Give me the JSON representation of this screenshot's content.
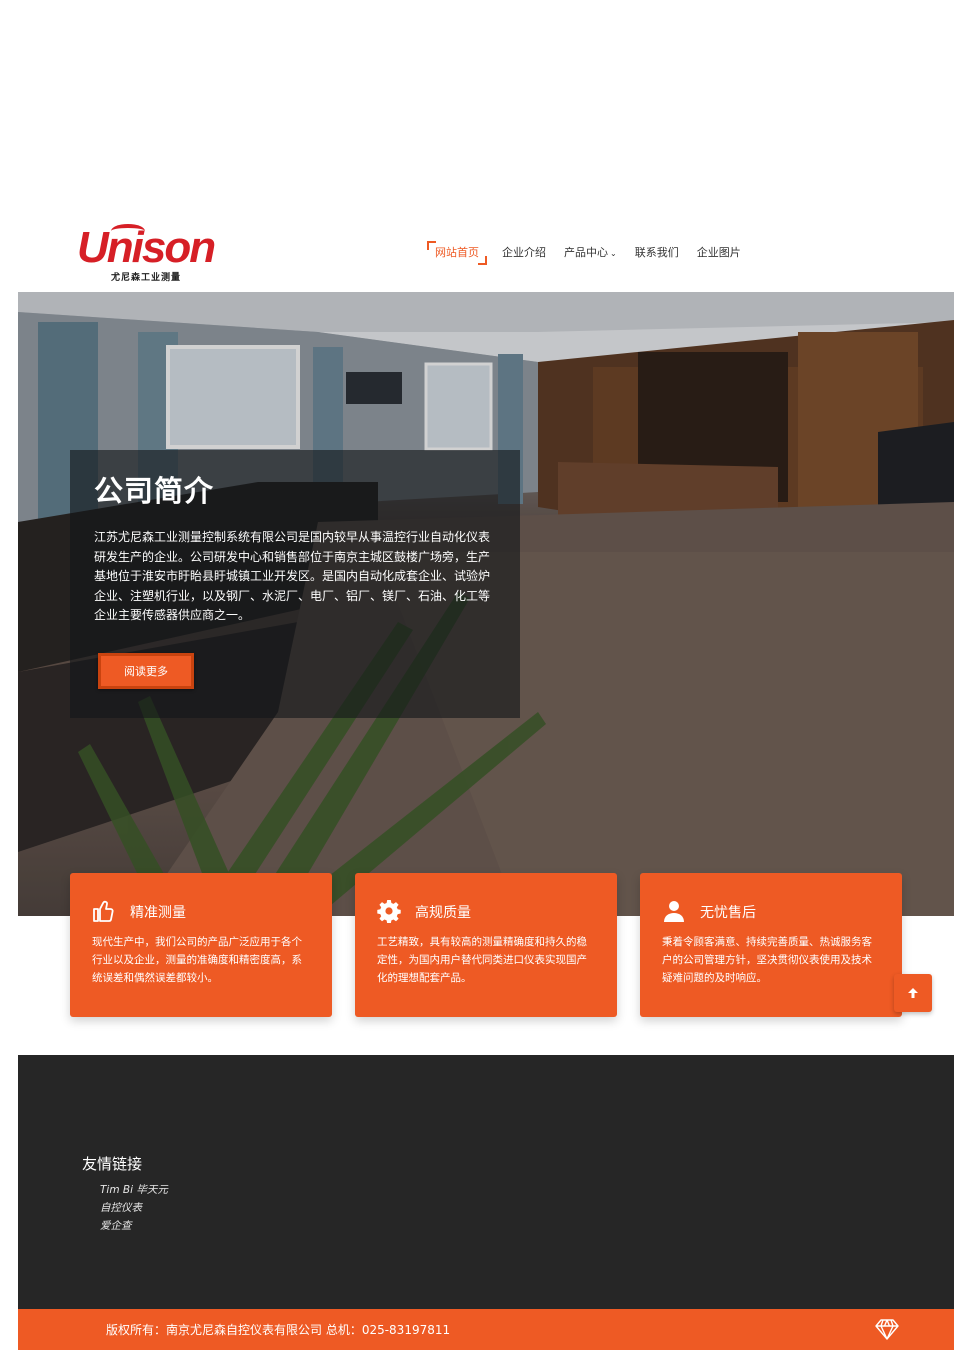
{
  "header": {
    "logo_text": "Unison",
    "logo_subtext": "尤尼森工业测量",
    "nav": [
      {
        "label": "网站首页",
        "active": true
      },
      {
        "label": "企业介绍"
      },
      {
        "label": "产品中心",
        "caret": "chevron-down-icon"
      },
      {
        "label": "联系我们"
      },
      {
        "label": "企业图片"
      }
    ]
  },
  "hero": {
    "title": "公司简介",
    "text": "江苏尤尼森工业测量控制系统有限公司是国内较早从事温控行业自动化仪表研发生产的企业。公司研发中心和销售部位于南京主城区鼓楼广场旁，生产基地位于淮安市盱眙县盱城镇工业开发区。是国内自动化成套企业、试验炉企业、注塑机行业，以及钢厂、水泥厂、电厂、铝厂、镁厂、石油、化工等企业主要传感器供应商之一。",
    "button_label": "阅读更多"
  },
  "features": [
    {
      "icon": "thumbs-up-icon",
      "title": "精准测量",
      "text": "现代生产中，我们公司的产品广泛应用于各个行业以及企业，测量的准确度和精密度高，系统误差和偶然误差都较小。"
    },
    {
      "icon": "gear-icon",
      "title": "高规质量",
      "text": "工艺精致，具有较高的测量精确度和持久的稳定性，为国内用户替代同类进口仪表实现国产化的理想配套产品。"
    },
    {
      "icon": "user-icon",
      "title": "无忧售后",
      "text": "秉着令顾客满意、持续完善质量、热诚服务客户的公司管理方针，坚决贯彻仪表使用及技术疑难问题的及时响应。"
    }
  ],
  "back_to_top_icon": "arrow-up-icon",
  "footer": {
    "links_title": "友情链接",
    "links": [
      "Tim Bi 毕天元",
      "自控仪表",
      "爱企查"
    ],
    "copyright": "版权所有：南京尤尼森自控仪表有限公司 总机：025-83197811",
    "badge_icon": "diamond-icon"
  },
  "colors": {
    "accent": "#ee5a24",
    "footer_bg": "#262626",
    "logo_red": "#d61f26"
  }
}
